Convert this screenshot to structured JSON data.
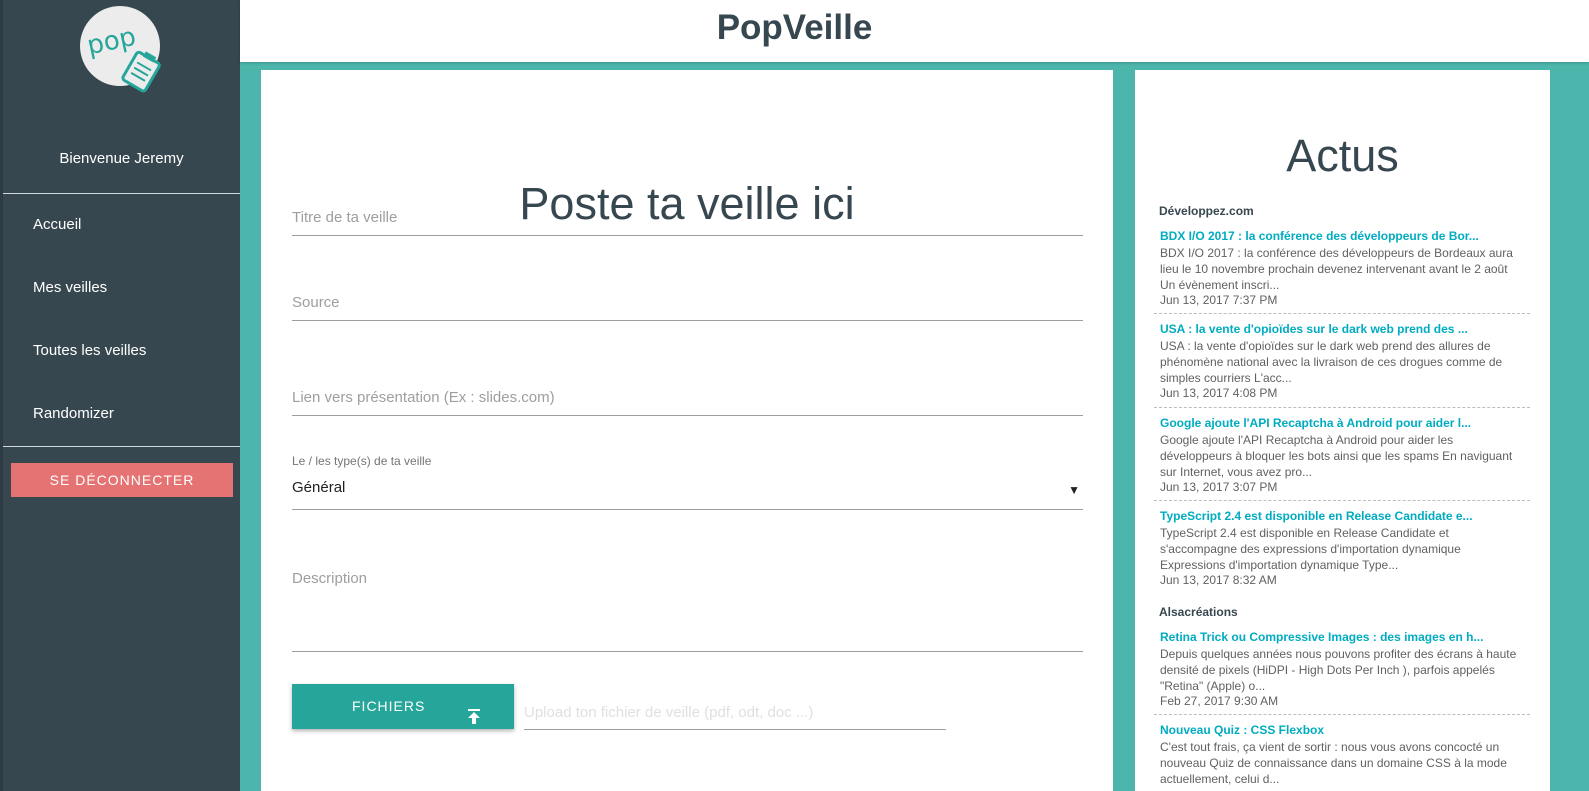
{
  "app": {
    "title": "PopVeille"
  },
  "sidebar": {
    "logo_text": "pop",
    "welcome": "Bienvenue Jeremy",
    "items": [
      {
        "label": "Accueil"
      },
      {
        "label": "Mes veilles"
      },
      {
        "label": "Toutes les veilles"
      },
      {
        "label": "Randomizer"
      }
    ],
    "logout_label": "SE DÉCONNECTER"
  },
  "form": {
    "heading": "Poste ta veille ici",
    "title_placeholder": "Titre de ta veille",
    "source_placeholder": "Source",
    "link_placeholder": "Lien vers présentation (Ex : slides.com)",
    "type_label": "Le / les type(s) de ta veille",
    "type_value": "Général",
    "description_placeholder": "Description",
    "files_label": "FICHIERS",
    "upload_placeholder": "Upload ton fichier de veille (pdf, odt, doc ...)"
  },
  "news": {
    "heading": "Actus",
    "feeds": [
      {
        "name": "Développez.com",
        "articles": [
          {
            "title": "BDX I/O 2017 : la conférence des développeurs de Bor...",
            "desc": "BDX I/O 2017 : la conférence des développeurs de Bordeaux aura lieu le 10 novembre prochain devenez intervenant avant le 2 août Un évènement inscri...",
            "date": "Jun 13, 2017 7:37 PM"
          },
          {
            "title": "USA : la vente d'opioïdes sur le dark web prend des ...",
            "desc": "USA : la vente d'opioïdes sur le dark web prend des allures de phénomène national avec la livraison de ces drogues comme de simples courriers L'acc...",
            "date": "Jun 13, 2017 4:08 PM"
          },
          {
            "title": "Google ajoute l'API Recaptcha à Android pour aider l...",
            "desc": "Google ajoute l'API Recaptcha à Android pour aider les développeurs à bloquer les bots ainsi que les spams En naviguant sur Internet, vous avez pro...",
            "date": "Jun 13, 2017 3:07 PM"
          },
          {
            "title": "TypeScript 2.4 est disponible en Release Candidate e...",
            "desc": "TypeScript 2.4 est disponible en Release Candidate et s'accompagne des expressions d'importation dynamique Expressions d'importation dynamique Type...",
            "date": "Jun 13, 2017 8:32 AM"
          }
        ]
      },
      {
        "name": "Alsacréations",
        "articles": [
          {
            "title": "Retina Trick ou Compressive Images : des images en h...",
            "desc": "Depuis quelques années nous pouvons profiter des écrans à haute densité de pixels (HiDPI - High Dots Per Inch ), parfois appelés \"Retina\" (Apple) o...",
            "date": "Feb 27, 2017 9:30 AM"
          },
          {
            "title": "Nouveau Quiz : CSS Flexbox",
            "desc": "C'est tout frais, ça vient de sortir : nous vous avons concocté un nouveau Quiz de connaissance dans un domaine CSS à la mode actuellement, celui d...",
            "date": ""
          }
        ]
      }
    ]
  },
  "colors": {
    "sidebar_bg": "#37474f",
    "accent_teal": "#26a69a",
    "page_bg": "#4db6ac",
    "logout_red": "#e57373",
    "link_cyan": "#00acc1"
  }
}
